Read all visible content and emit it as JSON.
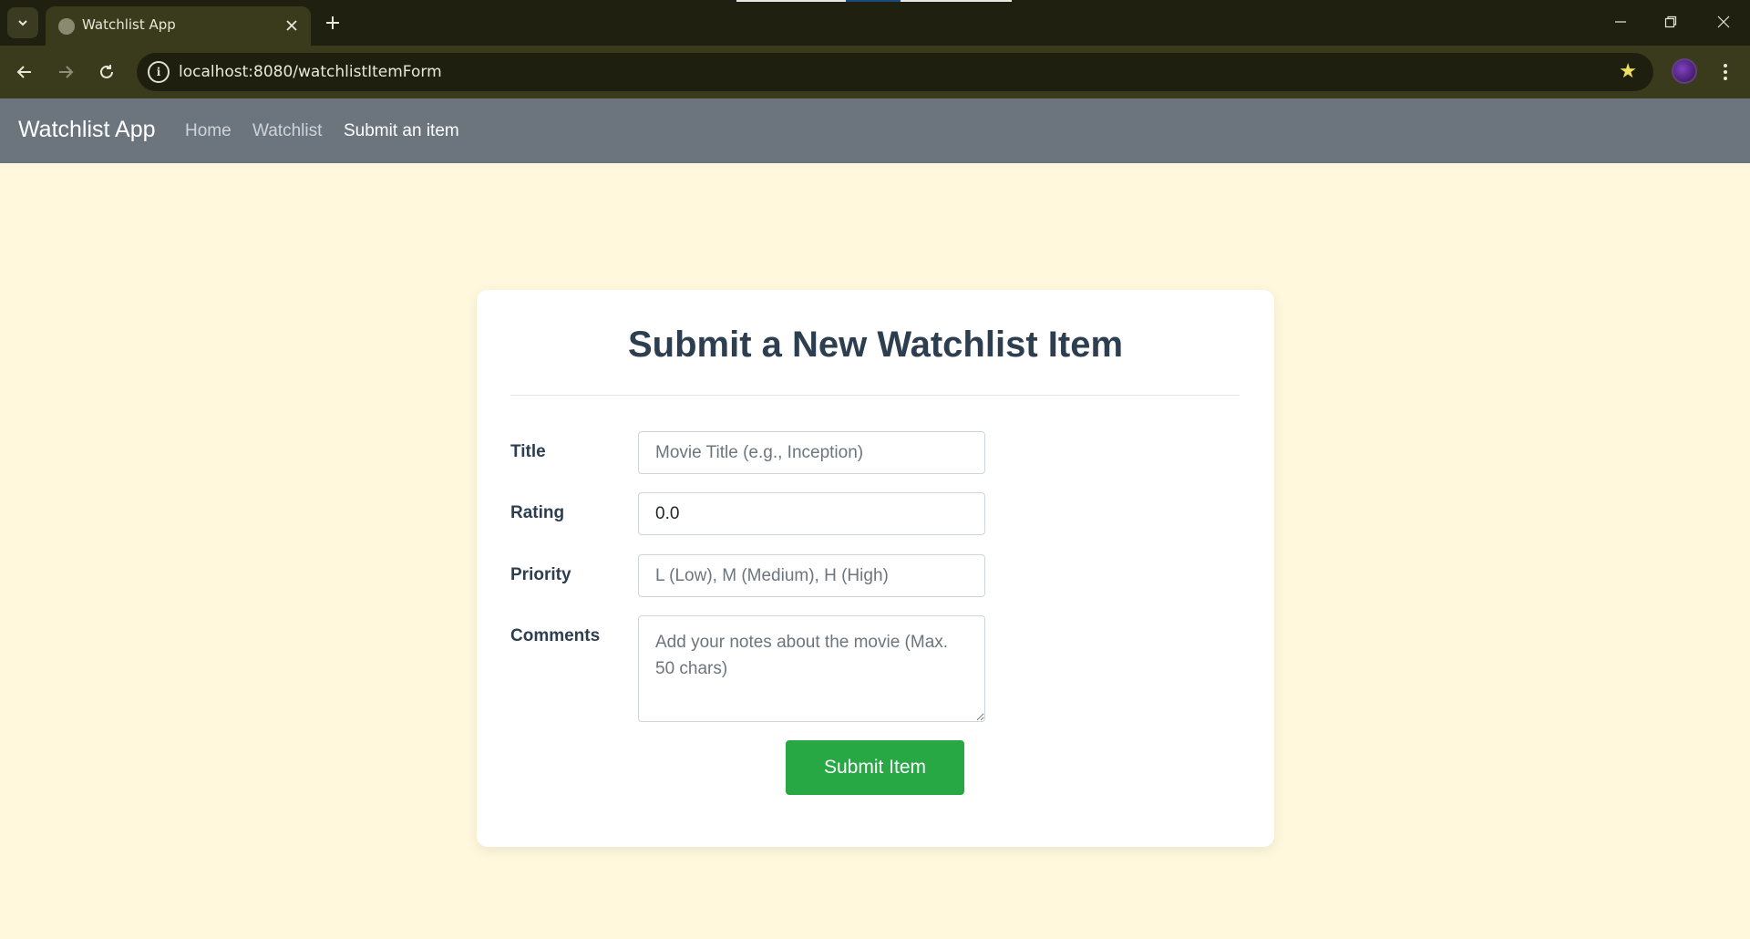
{
  "browser": {
    "tab_title": "Watchlist App",
    "url": "localhost:8080/watchlistItemForm",
    "icons": {
      "tab_search": "chevron-down-icon",
      "tab_close": "close-icon",
      "new_tab": "plus-icon",
      "back": "arrow-left-icon",
      "forward": "arrow-right-icon",
      "reload": "reload-icon",
      "site_info": "info-icon",
      "bookmark": "star-icon",
      "menu": "kebab-menu-icon"
    }
  },
  "navbar": {
    "brand": "Watchlist App",
    "links": [
      {
        "label": "Home",
        "active": false
      },
      {
        "label": "Watchlist",
        "active": false
      },
      {
        "label": "Submit an item",
        "active": true
      }
    ]
  },
  "form": {
    "title": "Submit a New Watchlist Item",
    "fields": {
      "title": {
        "label": "Title",
        "value": "",
        "placeholder": "Movie Title (e.g., Inception)"
      },
      "rating": {
        "label": "Rating",
        "value": "0.0",
        "placeholder": ""
      },
      "priority": {
        "label": "Priority",
        "value": "",
        "placeholder": "L (Low), M (Medium), H (High)"
      },
      "comments": {
        "label": "Comments",
        "value": "",
        "placeholder": "Add your notes about the movie (Max. 50 chars)"
      }
    },
    "submit_label": "Submit Item"
  },
  "colors": {
    "page_background": "#fff8dc",
    "navbar_background": "#6c757d",
    "heading_text": "#2c3e50",
    "submit_button": "#28a745"
  }
}
